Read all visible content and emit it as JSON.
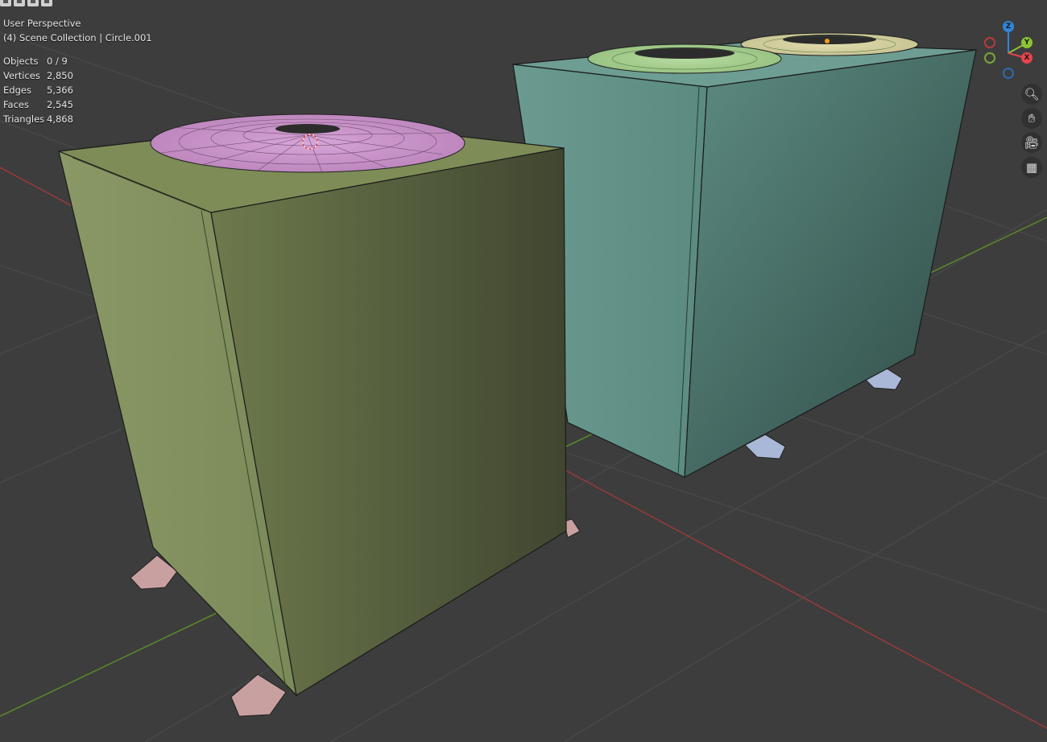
{
  "viewport": {
    "view_name": "User Perspective",
    "collection_path": "(4) Scene Collection | Circle.001"
  },
  "stats": [
    {
      "label": "Objects",
      "value": "0 / 9"
    },
    {
      "label": "Vertices",
      "value": "2,850"
    },
    {
      "label": "Edges",
      "value": "5,366"
    },
    {
      "label": "Faces",
      "value": "2,545"
    },
    {
      "label": "Triangles",
      "value": "4,868"
    }
  ],
  "gizmo": {
    "z": "Z",
    "y": "Y",
    "x": "X",
    "colors": {
      "x": "#e8434d",
      "y": "#8cc433",
      "z": "#2f86d8"
    }
  },
  "nav_icons": [
    "zoom-icon",
    "pan-hand-icon",
    "camera-icon",
    "perspective-grid-icon"
  ],
  "colors": {
    "background": "#3d3d3d",
    "grid": "#4a4a4a",
    "x_axis": "#9a3a3a",
    "y_axis": "#5a8a2a",
    "left_box": "#7a8a55",
    "right_box": "#4e7f76",
    "left_fan": "#c893c8",
    "right_fan_front": "#a7cd8c",
    "right_fan_back": "#d4d1a3"
  }
}
